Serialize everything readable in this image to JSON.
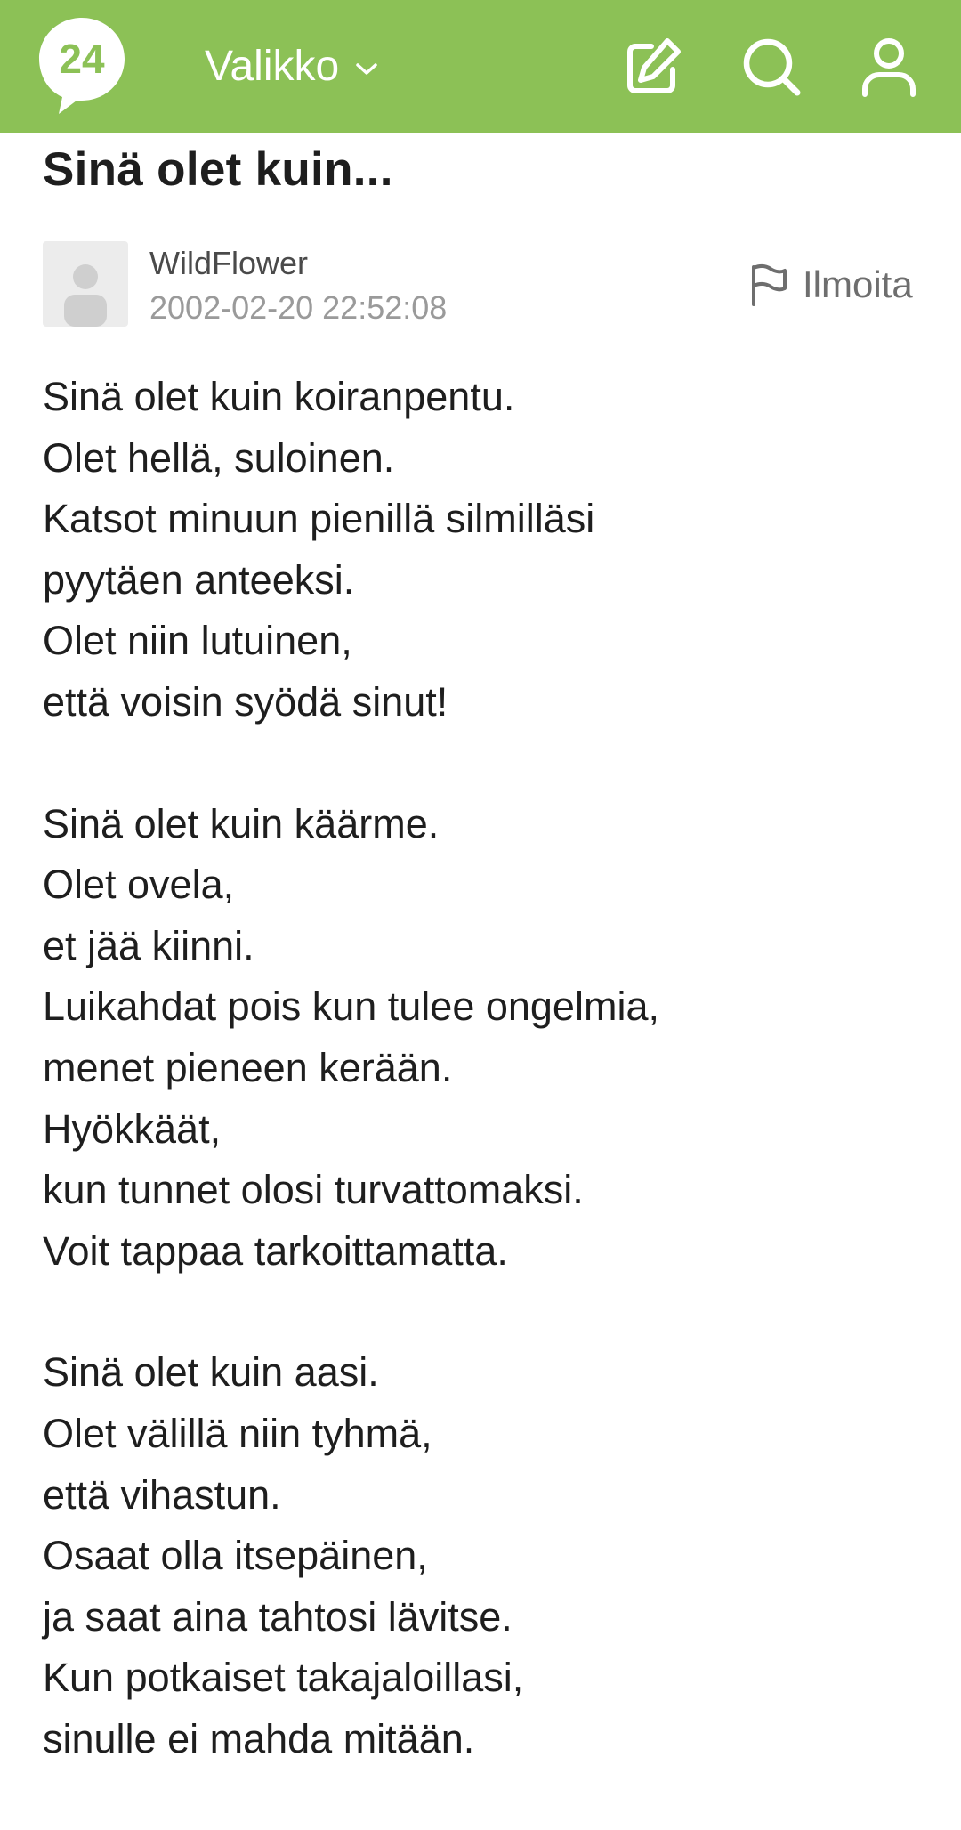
{
  "header": {
    "logo_text": "24",
    "menu_label": "Valikko",
    "brand_color": "#8cc156",
    "icons": [
      "logo-bubble-icon",
      "chevron-down-icon",
      "edit-icon",
      "search-icon",
      "user-icon"
    ]
  },
  "post": {
    "title": "Sinä olet kuin...",
    "author": "WildFlower",
    "timestamp": "2002-02-20 22:52:08",
    "report_label": "Ilmoita",
    "report_icon": "flag-icon",
    "stanzas": [
      [
        "Sinä olet kuin koiranpentu.",
        "Olet hellä, suloinen.",
        "Katsot minuun pienillä silmilläsi",
        "pyytäen anteeksi.",
        "Olet niin lutuinen,",
        "että voisin syödä sinut!"
      ],
      [
        "Sinä olet kuin käärme.",
        "Olet ovela,",
        "et jää kiinni.",
        "Luikahdat pois kun tulee ongelmia,",
        "menet pieneen kerään.",
        "Hyökkäät,",
        "kun tunnet olosi turvattomaksi.",
        "Voit tappaa tarkoittamatta."
      ],
      [
        "Sinä olet kuin aasi.",
        "Olet välillä niin tyhmä,",
        "että vihastun.",
        "Osaat olla itsepäinen,",
        "ja saat aina tahtosi lävitse.",
        "Kun potkaiset takajaloillasi,",
        "sinulle ei mahda mitään."
      ]
    ]
  }
}
